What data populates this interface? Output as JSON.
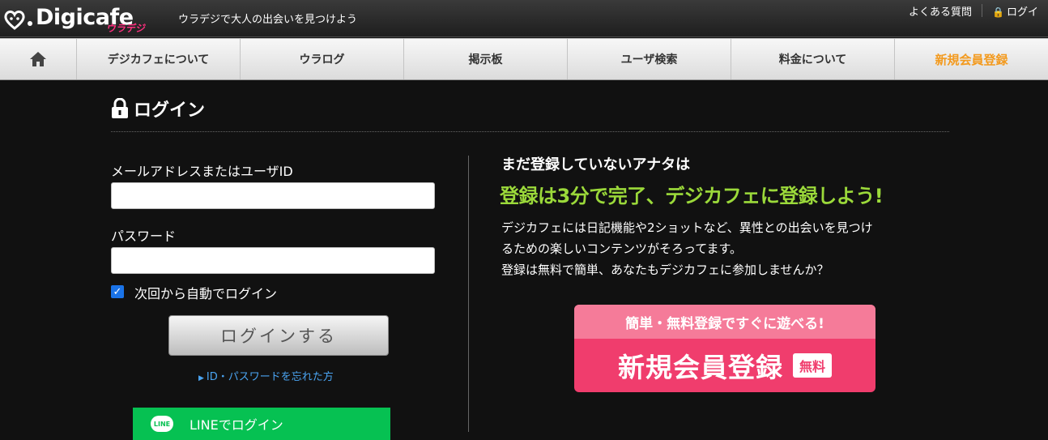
{
  "header": {
    "logo_text": "Digicafe",
    "logo_sub": "ウラデジ",
    "tagline": "ウラデジで大人の出会いを見つけよう",
    "links": [
      {
        "label": "よくある質問"
      },
      {
        "label": "ログイ"
      }
    ]
  },
  "nav": {
    "items": [
      {
        "label": "デジカフェについて"
      },
      {
        "label": "ウラログ"
      },
      {
        "label": "掲示板"
      },
      {
        "label": "ユーザ検索"
      },
      {
        "label": "料金について"
      },
      {
        "label": "新規会員登録"
      }
    ]
  },
  "login": {
    "title": "ログイン",
    "email_label": "メールアドレスまたはユーザID",
    "email_value": "",
    "password_label": "パスワード",
    "password_value": "",
    "remember_label": "次回から自動でログイン",
    "remember_checked": true,
    "submit_label": "ログインする",
    "forgot_label": "ID・パスワードを忘れた方",
    "line_icon_text": "LINE",
    "line_label": "LINEでログイン"
  },
  "promo": {
    "heading": "まだ登録していないアナタは",
    "catch": "登録は3分で完了、デジカフェに登録しよう!",
    "body_lines": [
      "デジカフェには日記機能や2ショットなど、異性との出会いを見つけ",
      "るための楽しいコンテンツがそろってます。",
      "登録は無料で簡単、あなたもデジカフェに参加しませんか？"
    ],
    "signup_top": "簡単・無料登録ですぐに遊べる!",
    "signup_label": "新規会員登録",
    "free_badge": "無料"
  },
  "colors": {
    "accent_orange": "#f39a1e",
    "catch_green": "#9bd93a",
    "signup_pink": "#f03d6d",
    "line_green": "#06c152",
    "link_blue": "#4aa3f0"
  }
}
